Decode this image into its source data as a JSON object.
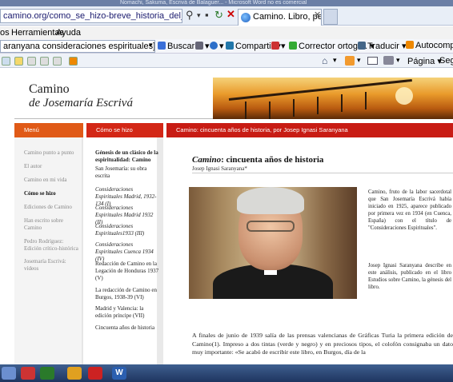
{
  "window": {
    "title_partial": "Nomachi, Sakuma, Escrivá de Balaguer... - Microsoft Word no es comercial"
  },
  "browser": {
    "url": "camino.org/como_se_hizo-breve_historia_del_libro.php",
    "tab_title": "Camino. Libro, pelíc...",
    "menu": [
      "os",
      "Herramientas",
      "Ayuda"
    ],
    "search_value": "aranyana consideraciones espirituales]",
    "toolbar": {
      "buscar": "Buscar",
      "compartir": "Compartir",
      "corrector": "Corrector ortogr...",
      "traducir": "Traducir",
      "autocompletar": "Autocompletar"
    },
    "cmd": {
      "pagina": "Página",
      "seguridad": "Segu"
    }
  },
  "site": {
    "logo_line1": "Camino",
    "logo_line2": "de Josemaría Escrivá",
    "bars": {
      "menu": "Menú",
      "como": "Cómo se hizo",
      "title": "Camino: cincuenta años de historia, por Josep Ignasi Saranyana"
    },
    "left_nav": [
      "Camino punto a punto",
      "El autor",
      "Camino en mi vida",
      "Cómo se hizo",
      "Ediciones de Camino",
      "Han escrito sobre Camino",
      "Pedro Rodríguez: Edición crítico-histórica",
      "Josemaría Escrivá: vídeos"
    ],
    "mid_nav": [
      "Génesis de un clásico de la espiritualidad: Camino",
      "San Josemaría: su obra escrita",
      "Consideraciones Espirituales Madrid, 1932-134 (I)",
      "Consideraciones Espirituales Madrid 1932 (II)",
      "Consideraciones Espirituales1933 (III)",
      "Consideraciones Espirituales Cuenca 1934 (IV)",
      "Redacción de Camino en la Legación de Honduras 1937 (V)",
      "La redacción de Camino en Burgos, 1938-39 (VI)",
      "Madrid y Valencia: la edición príncipe (VII)",
      "Cincuenta años de historia"
    ],
    "article": {
      "title_em": "Camino",
      "title_rest": ": cincuenta años de historia",
      "author": "Josep Ignasi Saranyana*",
      "side_para1": "Camino, fruto de la labor sacerdotal que San Josemaría Escrivá había iniciado en 1925, aparece publicado por primera vez en 1934 (en Cuenca, España) con el título de \"Consideraciones Espirituales\".",
      "side_para2": "Josep Ignasi Saranyana describe en este análisis, publicado en el libro Estudios sobre Camino, la génesis del libro.",
      "body": "A finales de junio de 1939 salía de las prensas valencianas de Gráficas Turia la primera edición de Camino(1). Impreso a dos tintas (verde y negro) y en preciosos tipos, el colofón consignaba un dato muy importante: «Se acabó de escribir este libro, en Burgos, día de la"
    }
  },
  "taskbar": {
    "word_label": "W"
  },
  "colors": {
    "menu_bar": "#e05a17",
    "como_bar": "#d32716",
    "title_bar": "#c81c14"
  }
}
